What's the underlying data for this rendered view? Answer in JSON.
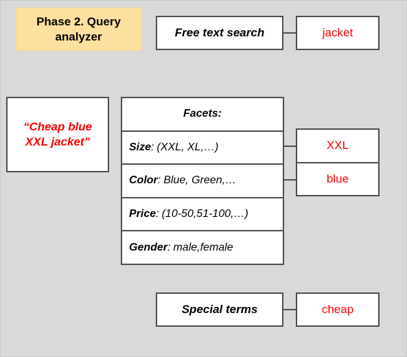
{
  "page": {
    "background_color": "#d9d9d9",
    "accent_yellow": "#fbe0a0",
    "value_color": "#ff0000",
    "line_color": "#4d4d4d"
  },
  "phase_banner": {
    "label": "Phase 2. Query analyzer"
  },
  "query": {
    "text": "“Cheap blue XXL jacket”"
  },
  "free_text": {
    "label": "Free text search",
    "value": "jacket"
  },
  "special_terms": {
    "label": "Special terms",
    "value": "cheap"
  },
  "facets": {
    "header": "Facets:",
    "rows": [
      {
        "key": "Size",
        "separator": ":",
        "value": "(XXL, XL,…)"
      },
      {
        "key": "Color",
        "separator": ":",
        "value": "Blue, Green,…"
      },
      {
        "key": "Price",
        "separator": ":",
        "value": "(10-50,51-100,…)"
      },
      {
        "key": "Gender",
        "separator": ":",
        "value": "male,female"
      }
    ]
  },
  "facet_values": [
    {
      "label": "XXL"
    },
    {
      "label": "blue"
    }
  ]
}
